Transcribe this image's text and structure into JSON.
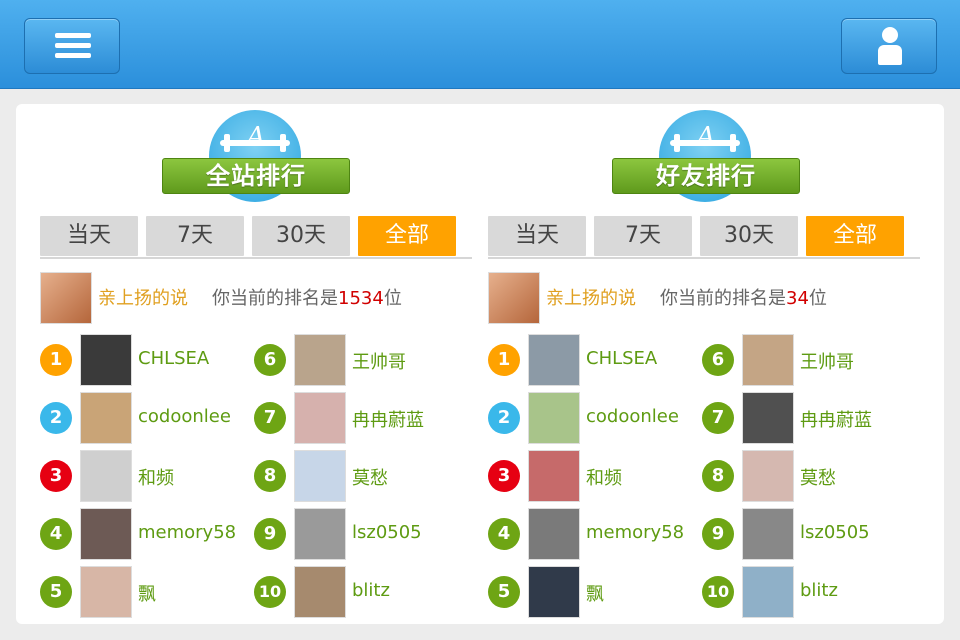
{
  "header": {
    "menu_icon": "hamburger-menu-icon",
    "user_icon": "user-profile-icon",
    "accent": "#2b8fdb"
  },
  "panels": [
    {
      "title": "全站排行",
      "tabs": [
        "当天",
        "7天",
        "30天",
        "全部"
      ],
      "active_tab": 3,
      "me": {
        "name": "亲上扬的说",
        "rank_prefix": "你当前的排名是",
        "rank": "1534",
        "rank_suffix": "位"
      },
      "entries": [
        {
          "rank": "1",
          "name": "CHLSEA"
        },
        {
          "rank": "2",
          "name": "codoonlee"
        },
        {
          "rank": "3",
          "name": "和频"
        },
        {
          "rank": "4",
          "name": "memory58"
        },
        {
          "rank": "5",
          "name": "飘"
        },
        {
          "rank": "6",
          "name": "王帅哥"
        },
        {
          "rank": "7",
          "name": "冉冉蔚蓝"
        },
        {
          "rank": "8",
          "name": "莫愁"
        },
        {
          "rank": "9",
          "name": "lsz0505"
        },
        {
          "rank": "10",
          "name": "blitz"
        }
      ]
    },
    {
      "title": "好友排行",
      "tabs": [
        "当天",
        "7天",
        "30天",
        "全部"
      ],
      "active_tab": 3,
      "me": {
        "name": "亲上扬的说",
        "rank_prefix": "你当前的排名是",
        "rank": "34",
        "rank_suffix": "位"
      },
      "entries": [
        {
          "rank": "1",
          "name": "CHLSEA"
        },
        {
          "rank": "2",
          "name": "codoonlee"
        },
        {
          "rank": "3",
          "name": "和频"
        },
        {
          "rank": "4",
          "name": "memory58"
        },
        {
          "rank": "5",
          "name": "飘"
        },
        {
          "rank": "6",
          "name": "王帅哥"
        },
        {
          "rank": "7",
          "name": "冉冉蔚蓝"
        },
        {
          "rank": "8",
          "name": "莫愁"
        },
        {
          "rank": "9",
          "name": "lsz0505"
        },
        {
          "rank": "10",
          "name": "blitz"
        }
      ]
    }
  ],
  "colors": {
    "medal_gold": "#ffa200",
    "medal_silver": "#3ab8ea",
    "medal_bronze": "#e60012",
    "medal_other": "#6ea514",
    "name_green": "#5e9b12",
    "rank_red": "#d10000",
    "tab_active": "#ffa200"
  }
}
